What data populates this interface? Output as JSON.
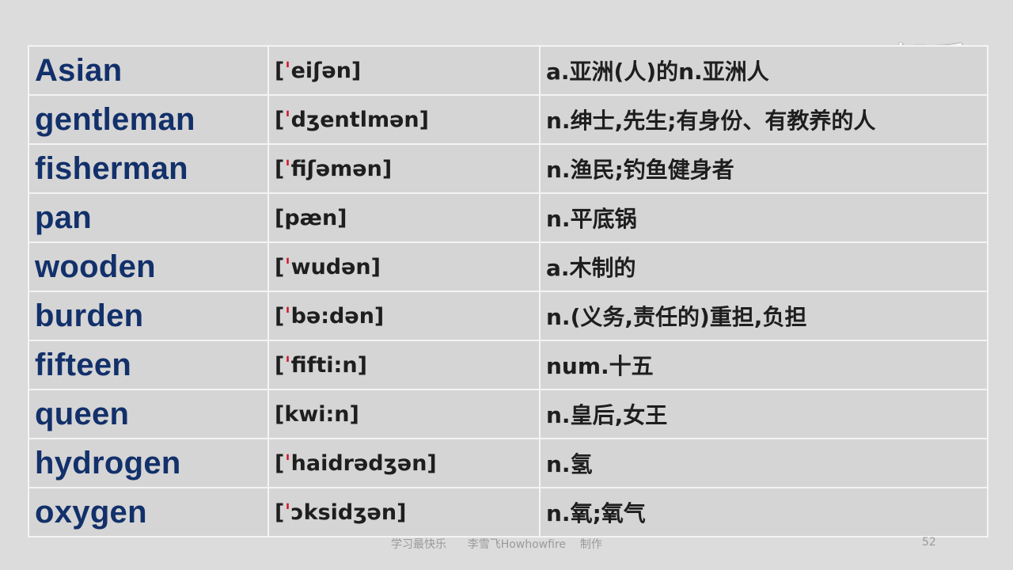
{
  "watermark": "知乎",
  "vocabulary": [
    {
      "word": "Asian",
      "phonetic_open": "[",
      "stress": "ˈ",
      "phonetic_rest": "eiʃən]",
      "definition": "a.亚洲(人)的n.亚洲人"
    },
    {
      "word": "gentleman",
      "phonetic_open": "[",
      "stress": "ˈ",
      "phonetic_rest": "dʒentlmən]",
      "definition": "n.绅士,先生;有身份、有教养的人"
    },
    {
      "word": "fisherman",
      "phonetic_open": "[",
      "stress": "ˈ",
      "phonetic_rest": "fiʃəmən]",
      "definition": "n.渔民;钓鱼健身者"
    },
    {
      "word": "pan",
      "phonetic_open": "[",
      "stress": "",
      "phonetic_rest": "pæn]",
      "definition": "n.平底锅"
    },
    {
      "word": "wooden",
      "phonetic_open": "[",
      "stress": "ˈ",
      "phonetic_rest": "wudən]",
      "definition": "a.木制的"
    },
    {
      "word": "burden",
      "phonetic_open": "[",
      "stress": "ˈ",
      "phonetic_rest": "bə:dən]",
      "definition": "n.(义务,责任的)重担,负担"
    },
    {
      "word": "fifteen",
      "phonetic_open": "[",
      "stress": "ˈ",
      "phonetic_rest": "fifti:n]",
      "definition": "num.十五"
    },
    {
      "word": "queen",
      "phonetic_open": "[",
      "stress": "",
      "phonetic_rest": "kwi:n]",
      "definition": "n.皇后,女王"
    },
    {
      "word": "hydrogen",
      "phonetic_open": "[",
      "stress": "ˈ",
      "phonetic_rest": "haidrədʒən]",
      "definition": "n.氢"
    },
    {
      "word": "oxygen",
      "phonetic_open": "[",
      "stress": "ˈ",
      "phonetic_rest": "ɔksidʒən]",
      "definition": "n.氧;氧气"
    }
  ],
  "footer": {
    "credit": "学习最快乐      李雪飞Howhowfire    制作",
    "page_number": "52"
  }
}
